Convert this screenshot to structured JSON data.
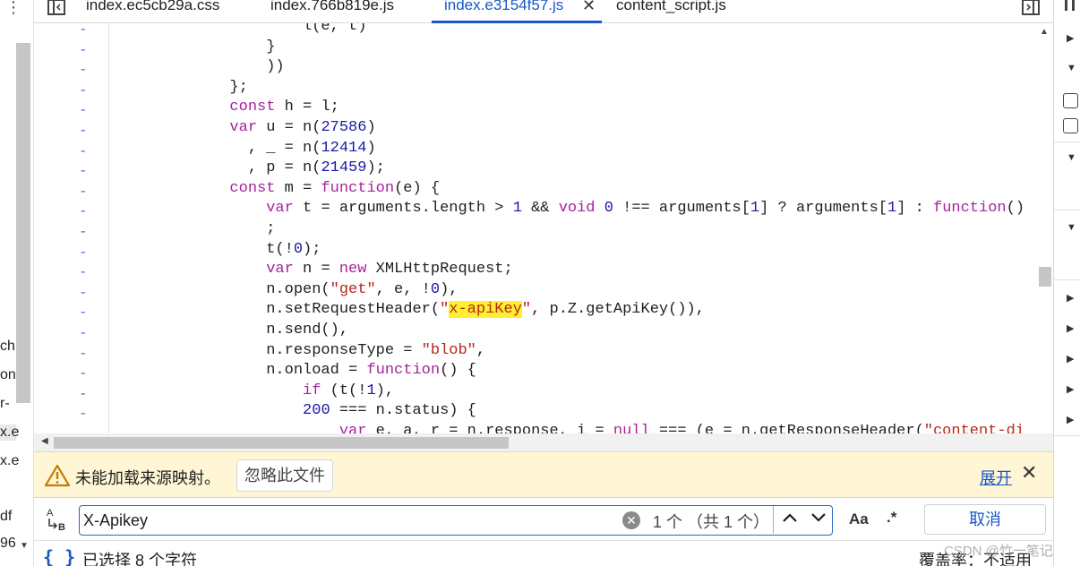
{
  "left_pane": {
    "partial_labels": [
      "ch",
      "on",
      "r-",
      "x.e",
      "x.e",
      "df",
      "96"
    ]
  },
  "tabs": [
    {
      "label": "index.ec5cb29a.css",
      "active": false
    },
    {
      "label": "index.766b819e.js",
      "active": false
    },
    {
      "label": "index.e3154f57.js",
      "active": true
    },
    {
      "label": "content_script.js",
      "active": false
    }
  ],
  "editor": {
    "gutter_marker": "-",
    "lines": [
      [
        {
          "t": "                    l(e, t)",
          "c": "var"
        }
      ],
      [
        {
          "t": "                }",
          "c": "var"
        }
      ],
      [
        {
          "t": "                ))",
          "c": "var"
        }
      ],
      [
        {
          "t": "            };",
          "c": "var"
        }
      ],
      [
        {
          "t": "            ",
          "c": "var"
        },
        {
          "t": "const",
          "c": "kw"
        },
        {
          "t": " h = l;",
          "c": "var"
        }
      ],
      [
        {
          "t": "            ",
          "c": "var"
        },
        {
          "t": "var",
          "c": "kw"
        },
        {
          "t": " u = n(",
          "c": "var"
        },
        {
          "t": "27586",
          "c": "num"
        },
        {
          "t": ")",
          "c": "var"
        }
      ],
      [
        {
          "t": "              , _ = n(",
          "c": "var"
        },
        {
          "t": "12414",
          "c": "num"
        },
        {
          "t": ")",
          "c": "var"
        }
      ],
      [
        {
          "t": "              , p = n(",
          "c": "var"
        },
        {
          "t": "21459",
          "c": "num"
        },
        {
          "t": ");",
          "c": "var"
        }
      ],
      [
        {
          "t": "            ",
          "c": "var"
        },
        {
          "t": "const",
          "c": "kw"
        },
        {
          "t": " m = ",
          "c": "var"
        },
        {
          "t": "function",
          "c": "kw"
        },
        {
          "t": "(e) {",
          "c": "var"
        }
      ],
      [
        {
          "t": "                ",
          "c": "var"
        },
        {
          "t": "var",
          "c": "kw"
        },
        {
          "t": " t = arguments.length > ",
          "c": "var"
        },
        {
          "t": "1",
          "c": "num"
        },
        {
          "t": " && ",
          "c": "var"
        },
        {
          "t": "void",
          "c": "kw"
        },
        {
          "t": " ",
          "c": "var"
        },
        {
          "t": "0",
          "c": "num"
        },
        {
          "t": " !== arguments[",
          "c": "var"
        },
        {
          "t": "1",
          "c": "num"
        },
        {
          "t": "] ? arguments[",
          "c": "var"
        },
        {
          "t": "1",
          "c": "num"
        },
        {
          "t": "] : ",
          "c": "var"
        },
        {
          "t": "function",
          "c": "kw"
        },
        {
          "t": "()",
          "c": "var"
        }
      ],
      [
        {
          "t": "                ;",
          "c": "var"
        }
      ],
      [
        {
          "t": "                t(!",
          "c": "var"
        },
        {
          "t": "0",
          "c": "num"
        },
        {
          "t": ");",
          "c": "var"
        }
      ],
      [
        {
          "t": "                ",
          "c": "var"
        },
        {
          "t": "var",
          "c": "kw"
        },
        {
          "t": " n = ",
          "c": "var"
        },
        {
          "t": "new",
          "c": "kw"
        },
        {
          "t": " XMLHttpRequest;",
          "c": "var"
        }
      ],
      [
        {
          "t": "                n.open(",
          "c": "var"
        },
        {
          "t": "\"get\"",
          "c": "str"
        },
        {
          "t": ", e, !",
          "c": "var"
        },
        {
          "t": "0",
          "c": "num"
        },
        {
          "t": "),",
          "c": "var"
        }
      ],
      [
        {
          "t": "                n.setRequestHeader(",
          "c": "var"
        },
        {
          "t": "\"",
          "c": "str"
        },
        {
          "t": "x-apiKey",
          "c": "str hl"
        },
        {
          "t": "\"",
          "c": "str"
        },
        {
          "t": ", p.Z.getApiKey()),",
          "c": "var"
        }
      ],
      [
        {
          "t": "                n.send(),",
          "c": "var"
        }
      ],
      [
        {
          "t": "                n.responseType = ",
          "c": "var"
        },
        {
          "t": "\"blob\"",
          "c": "str"
        },
        {
          "t": ",",
          "c": "var"
        }
      ],
      [
        {
          "t": "                n.onload = ",
          "c": "var"
        },
        {
          "t": "function",
          "c": "kw"
        },
        {
          "t": "() {",
          "c": "var"
        }
      ],
      [
        {
          "t": "                    ",
          "c": "var"
        },
        {
          "t": "if",
          "c": "kw"
        },
        {
          "t": " (t(!",
          "c": "var"
        },
        {
          "t": "1",
          "c": "num"
        },
        {
          "t": "),",
          "c": "var"
        }
      ],
      [
        {
          "t": "                    ",
          "c": "var"
        },
        {
          "t": "200",
          "c": "num"
        },
        {
          "t": " === n.status) {",
          "c": "var"
        }
      ],
      [
        {
          "t": "                        ",
          "c": "var"
        },
        {
          "t": "var",
          "c": "kw"
        },
        {
          "t": " e, a, r = n.response, i = ",
          "c": "var"
        },
        {
          "t": "null",
          "c": "kw"
        },
        {
          "t": " === (e = n.getResponseHeader(",
          "c": "var"
        },
        {
          "t": "\"content-di",
          "c": "str"
        }
      ]
    ]
  },
  "warning": {
    "message": "未能加载来源映射。",
    "ignore_label": "忽略此文件",
    "expand_label": "展开"
  },
  "search": {
    "replace_toggle_label": "A↳B",
    "query": "X-Apikey",
    "match_count": "1 个 （共 1 个）",
    "case_label": "Aa",
    "regex_label": ".*",
    "cancel_label": "取消"
  },
  "status": {
    "braces": "{ }",
    "selection_text": "已选择 8 个字符",
    "coverage_text": "覆盖率：不适用"
  },
  "watermark": "CSDN @竹一笔记",
  "colors": {
    "accent": "#1a56c4",
    "keyword": "#a7239c",
    "number": "#1a1aa6",
    "string": "#b5271b",
    "highlight": "#ffef30",
    "warning_bg": "#fef6d5"
  }
}
